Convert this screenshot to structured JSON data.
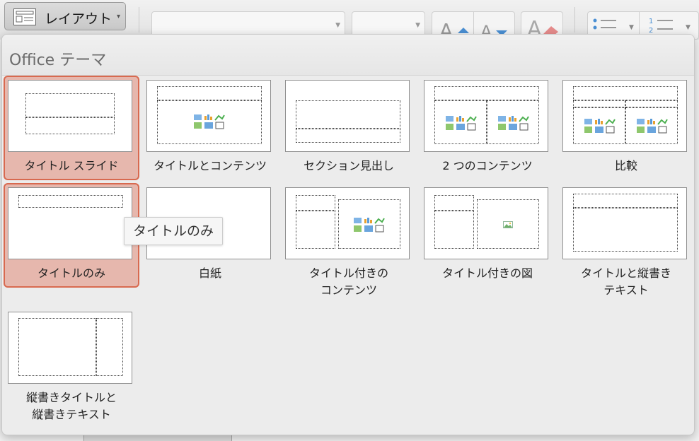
{
  "toolbar": {
    "layout_button_label": "レイアウト",
    "layout_button_caret": "▾"
  },
  "popover": {
    "title": "Office テーマ",
    "items": [
      {
        "label_lines": [
          "タイトル スライド"
        ]
      },
      {
        "label_lines": [
          "タイトルとコンテンツ"
        ]
      },
      {
        "label_lines": [
          "セクション見出し"
        ]
      },
      {
        "label_lines": [
          "2 つのコンテンツ"
        ]
      },
      {
        "label_lines": [
          "比較"
        ]
      },
      {
        "label_lines": [
          "タイトルのみ"
        ]
      },
      {
        "label_lines": [
          "白紙"
        ]
      },
      {
        "label_lines": [
          "タイトル付きの",
          "コンテンツ"
        ]
      },
      {
        "label_lines": [
          "タイトル付きの図"
        ]
      },
      {
        "label_lines": [
          "タイトルと縦書き",
          "テキスト"
        ]
      },
      {
        "label_lines": [
          "縦書きタイトルと",
          "縦書きテキスト"
        ]
      }
    ]
  },
  "tooltip": {
    "text": "タイトルのみ"
  },
  "colors": {
    "selection_fill": "#e6b7ad",
    "selection_border": "#d8694f",
    "popover_bg": "#ececec"
  }
}
